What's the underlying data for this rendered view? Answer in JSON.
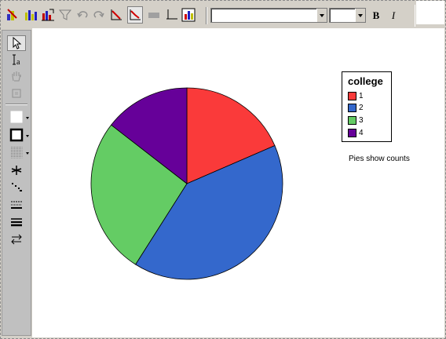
{
  "toolbar": {
    "icons": [
      "chart-wizard-icon",
      "bar-chart-icon",
      "chart-gallery-icon",
      "filter-icon",
      "undo-icon",
      "redo-icon",
      "axis-line-icon",
      "axis-selected-icon",
      "disabled-icon",
      "axis-icon",
      "chart-properties-icon"
    ],
    "font_combo_value": "",
    "size_combo_value": "",
    "bold_label": "B",
    "italic_label": "I"
  },
  "palette": {
    "icons": [
      "pointer-icon",
      "text-tool-icon",
      "hand-tool-icon",
      "frame-tool-icon",
      "fill-color-icon",
      "border-color-icon",
      "pattern-icon",
      "marker-icon",
      "line-style-icon",
      "dashed-line-icon",
      "line-weight-icon",
      "swap-axis-icon"
    ]
  },
  "chart_data": {
    "type": "pie",
    "title": "",
    "legend_title": "college",
    "legend_position": "right",
    "categories": [
      "1",
      "2",
      "3",
      "4"
    ],
    "values": [
      18.5,
      40.5,
      26.5,
      14.5
    ],
    "colors": [
      "#fa3a3a",
      "#3468cc",
      "#64cc64",
      "#660099"
    ],
    "note": "Pies show counts"
  }
}
